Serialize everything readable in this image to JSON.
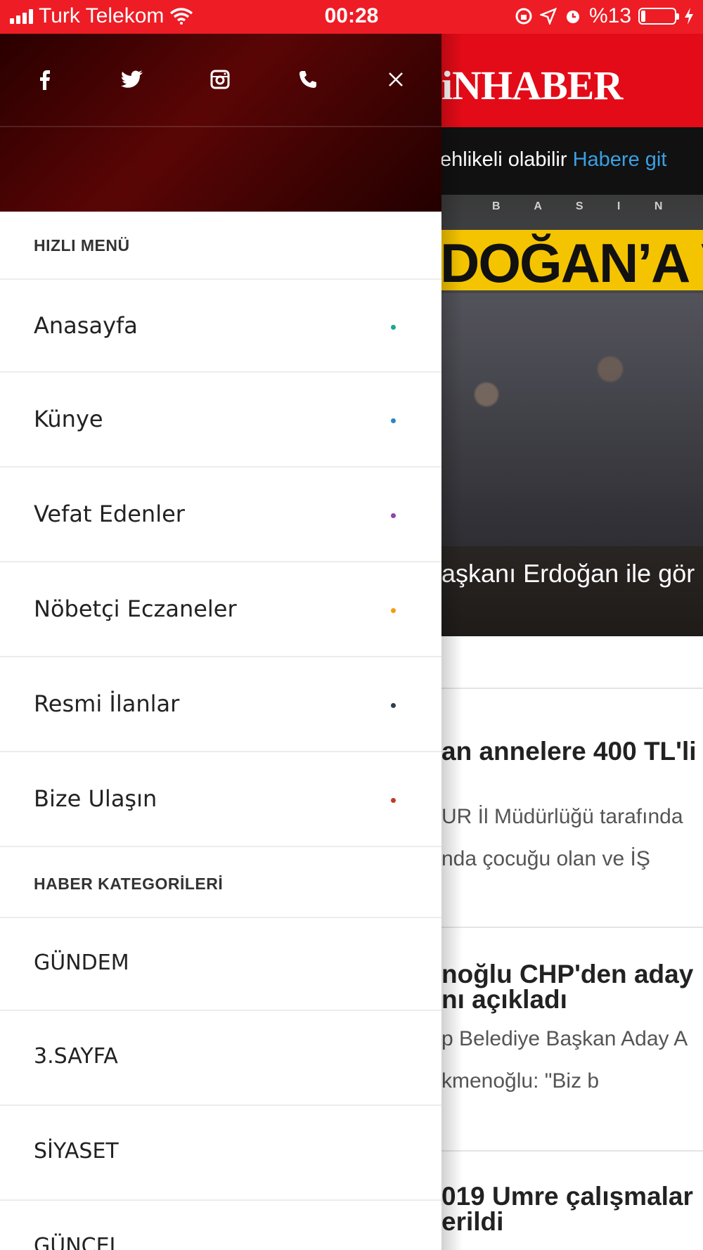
{
  "status_bar": {
    "carrier": "Turk Telekom",
    "time": "00:28",
    "battery_text": "%13",
    "battery_level": 0.13
  },
  "background_page": {
    "logo": "iNHABER",
    "ticker_text": "ehlikeli olabilir",
    "ticker_link": "Habere git",
    "hero_watermark": "B A S I N",
    "hero_banner": "DOĞAN’A VI",
    "hero_caption": "aşkanı Erdoğan ile gör",
    "news": [
      {
        "title_lines": [
          "an annelere 400 TL'li"
        ],
        "sub_lines": [
          "UR İl Müdürlüğü tarafında",
          "nda çocuğu olan ve İŞ"
        ]
      },
      {
        "title_lines": [
          "noğlu CHP'den aday",
          "nı açıkladı"
        ],
        "sub_lines": [
          "p Belediye Başkan Aday A",
          "kmenoğlu: \"Biz b"
        ]
      },
      {
        "title_lines": [
          "019 Umre çalışmalar",
          "erildi"
        ],
        "sub_lines": []
      }
    ]
  },
  "drawer": {
    "social_icons": [
      "facebook-icon",
      "twitter-icon",
      "instagram-icon",
      "phone-icon",
      "close-icon"
    ],
    "quick_menu_title": "HIZLI MENÜ",
    "quick_menu": [
      {
        "label": "Anasayfa",
        "dot_color": "#1aa78f"
      },
      {
        "label": "Künye",
        "dot_color": "#2e86c1"
      },
      {
        "label": "Vefat Edenler",
        "dot_color": "#8e44ad"
      },
      {
        "label": "Nöbetçi Eczaneler",
        "dot_color": "#f39c12"
      },
      {
        "label": "Resmi İlanlar",
        "dot_color": "#2c3e50"
      },
      {
        "label": "Bize Ulaşın",
        "dot_color": "#c0392b"
      }
    ],
    "categories_title": "HABER KATEGORİLERİ",
    "categories": [
      "GÜNDEM",
      "3.SAYFA",
      "SİYASET",
      "GÜNCEL"
    ]
  },
  "colors": {
    "brand_red": "#e30b17",
    "status_red": "#ee1c25",
    "link_blue": "#3aa0e4"
  }
}
